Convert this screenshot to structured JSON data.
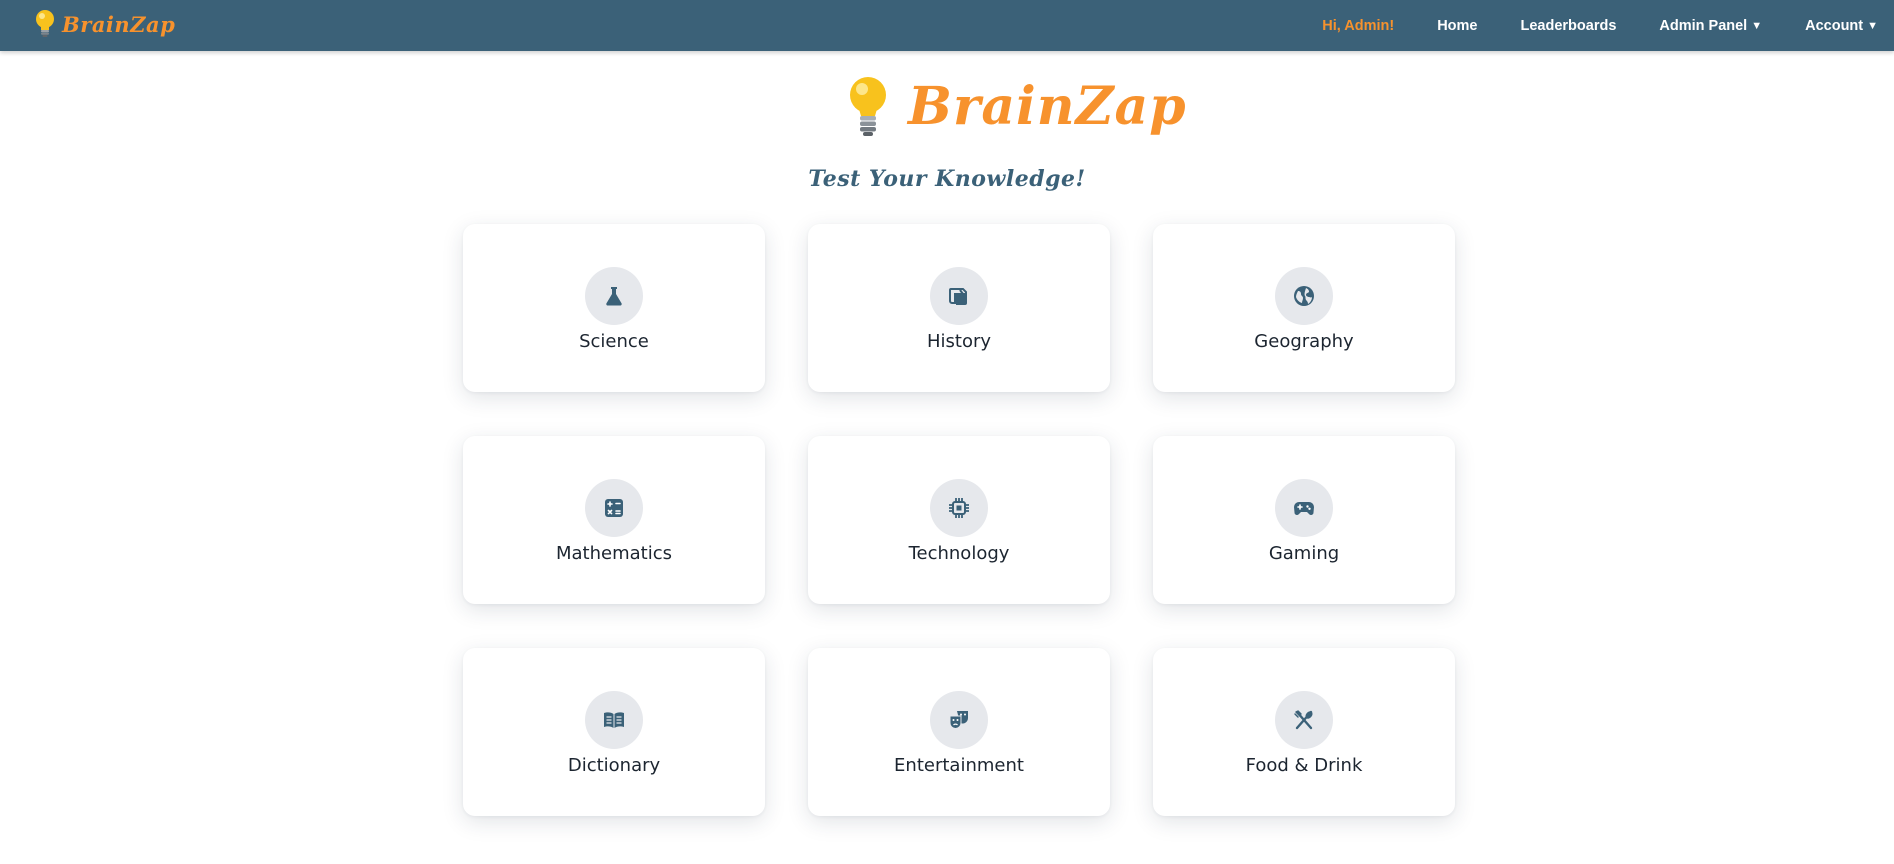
{
  "brand": {
    "name": "BrainZap"
  },
  "nav": {
    "greeting": "Hi, Admin!",
    "links": [
      {
        "label": "Home"
      },
      {
        "label": "Leaderboards"
      },
      {
        "label": "Admin Panel",
        "dropdown": true
      },
      {
        "label": "Account",
        "dropdown": true
      }
    ],
    "caret": "▼"
  },
  "hero": {
    "title": "BrainZap",
    "tagline": "Test Your Knowledge!"
  },
  "categories": [
    {
      "label": "Science",
      "icon": "flask-icon"
    },
    {
      "label": "History",
      "icon": "scroll-icon"
    },
    {
      "label": "Geography",
      "icon": "globe-icon"
    },
    {
      "label": "Mathematics",
      "icon": "calculator-icon"
    },
    {
      "label": "Technology",
      "icon": "microchip-icon"
    },
    {
      "label": "Gaming",
      "icon": "gamepad-icon"
    },
    {
      "label": "Dictionary",
      "icon": "book-icon"
    },
    {
      "label": "Entertainment",
      "icon": "masks-icon"
    },
    {
      "label": "Food & Drink",
      "icon": "utensils-icon"
    }
  ],
  "colors": {
    "navbar": "#3b6178",
    "accent": "#f7922d",
    "icon": "#3b6178",
    "icon_bg": "#e6e8ec"
  }
}
